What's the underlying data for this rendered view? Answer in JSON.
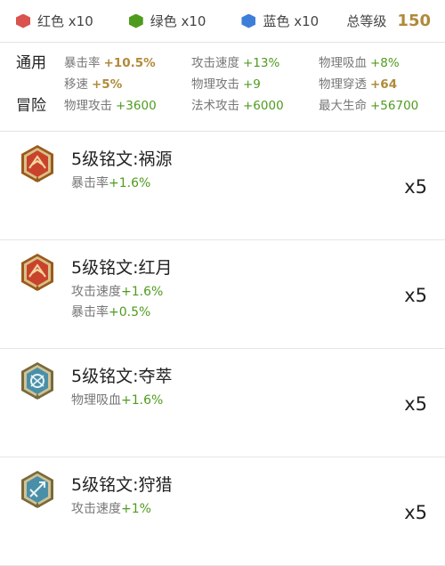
{
  "summary": {
    "colors": [
      {
        "label": "红色 x10",
        "color": "#d9534f"
      },
      {
        "label": "绿色 x10",
        "color": "#4f9b1e"
      },
      {
        "label": "蓝色 x10",
        "color": "#3d7ed8"
      }
    ],
    "total_label": "总等级",
    "total_value": "150"
  },
  "stats": {
    "general_label": "通用",
    "adventure_label": "冒险",
    "general": [
      {
        "name": "暴击率",
        "value": "+10.5%",
        "style": "gold"
      },
      {
        "name": "攻击速度",
        "value": "+13%",
        "style": "green"
      },
      {
        "name": "物理吸血",
        "value": "+8%",
        "style": "green"
      },
      {
        "name": "移速",
        "value": "+5%",
        "style": "gold"
      },
      {
        "name": "物理攻击",
        "value": "+9",
        "style": "green"
      },
      {
        "name": "物理穿透",
        "value": "+64",
        "style": "gold"
      }
    ],
    "adventure": [
      {
        "name": "物理攻击",
        "value": "+3600",
        "style": "green"
      },
      {
        "name": "法术攻击",
        "value": "+6000",
        "style": "green"
      },
      {
        "name": "最大生命",
        "value": "+56700",
        "style": "green"
      }
    ]
  },
  "inscriptions": [
    {
      "name": "5级铭文:祸源",
      "icon": "red-inscription-icon",
      "attrs": [
        {
          "label": "暴击率",
          "value": "+1.6%"
        }
      ],
      "count": "x5"
    },
    {
      "name": "5级铭文:红月",
      "icon": "red-inscription-icon",
      "attrs": [
        {
          "label": "攻击速度",
          "value": "+1.6%"
        },
        {
          "label": "暴击率",
          "value": "+0.5%"
        }
      ],
      "count": "x5"
    },
    {
      "name": "5级铭文:夺萃",
      "icon": "blue-inscription-icon",
      "attrs": [
        {
          "label": "物理吸血",
          "value": "+1.6%"
        }
      ],
      "count": "x5"
    },
    {
      "name": "5级铭文:狩猎",
      "icon": "blue-inscription-icon",
      "attrs": [
        {
          "label": "攻击速度",
          "value": "+1%"
        }
      ],
      "count": "x5"
    }
  ]
}
